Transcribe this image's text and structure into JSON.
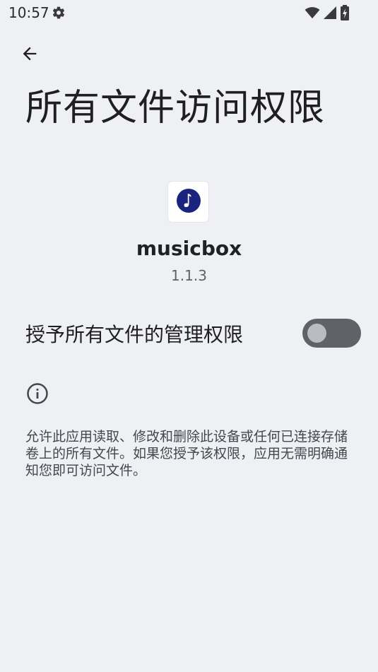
{
  "status_bar": {
    "time": "10:57",
    "icons": [
      "settings-gear-icon",
      "wifi-icon",
      "cell-signal-icon",
      "battery-charging-icon"
    ]
  },
  "header": {
    "back_icon": "arrow-back-icon",
    "title": "所有文件访问权限"
  },
  "app": {
    "icon": "music-note-icon",
    "name": "musicbox",
    "version": "1.1.3"
  },
  "permission": {
    "label": "授予所有文件的管理权限",
    "enabled": false
  },
  "info": {
    "icon": "info-icon",
    "description": "允许此应用读取、修改和删除此设备或任何已连接存储卷上的所有文件。如果您授予该权限，应用无需明确通知您即可访问文件。"
  },
  "colors": {
    "background": "#eef0f3",
    "toggle_track_off": "#5f6368",
    "toggle_knob_off": "#b9bcc0",
    "app_icon_accent": "#1a237e"
  }
}
